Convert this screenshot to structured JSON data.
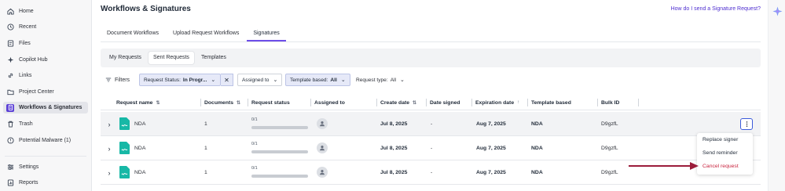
{
  "sidebar": {
    "items": [
      {
        "label": "Home",
        "icon": "home-icon"
      },
      {
        "label": "Recent",
        "icon": "clock-icon"
      },
      {
        "label": "Files",
        "icon": "files-icon"
      },
      {
        "label": "Copilot Hub",
        "icon": "sparkle-icon"
      },
      {
        "label": "Links",
        "icon": "link-icon"
      },
      {
        "label": "Project Center",
        "icon": "project-icon"
      },
      {
        "label": "Workflows & Signatures",
        "icon": "workflow-icon",
        "active": true
      },
      {
        "label": "Trash",
        "icon": "trash-icon"
      },
      {
        "label": "Potential Malware (1)",
        "icon": "shield-icon"
      },
      {
        "label": "Settings",
        "icon": "settings-icon"
      },
      {
        "label": "Reports",
        "icon": "reports-icon"
      }
    ]
  },
  "header": {
    "title": "Workflows & Signatures",
    "help_link": "How do I send a Signature Request?"
  },
  "tabs": [
    "Document Workflows",
    "Upload Request Workflows",
    "Signatures"
  ],
  "active_tab": "Signatures",
  "subtabs": [
    "My Requests",
    "Sent Requests",
    "Templates"
  ],
  "active_subtab": "Sent Requests",
  "filters": {
    "button_label": "Filters",
    "status_label": "Request Status:",
    "status_value": "In Progr...",
    "assigned_label": "Assigned to",
    "template_label": "Template based:",
    "template_value": "All",
    "type_label": "Request type:",
    "type_value": "All"
  },
  "table": {
    "columns": [
      "Request name",
      "Documents",
      "Request status",
      "Assigned to",
      "Create date",
      "Date signed",
      "Expiration date",
      "Template based",
      "Bulk ID"
    ],
    "rows": [
      {
        "name": "NDA",
        "documents": "1",
        "status_text": "0/1",
        "progress": 0,
        "create_date": "Jul 8, 2025",
        "date_signed": "-",
        "expiration_date": "Aug 7, 2025",
        "template": "NDA",
        "bulk_id": "D9gzfL"
      },
      {
        "name": "NDA",
        "documents": "1",
        "status_text": "0/1",
        "progress": 0,
        "create_date": "Jul 8, 2025",
        "date_signed": "-",
        "expiration_date": "Aug 7, 2025",
        "template": "NDA",
        "bulk_id": "D9gzfL"
      },
      {
        "name": "NDA",
        "documents": "1",
        "status_text": "0/1",
        "progress": 0,
        "create_date": "Jul 8, 2025",
        "date_signed": "-",
        "expiration_date": "Aug 7, 2025",
        "template": "NDA",
        "bulk_id": "D9gzfL"
      }
    ]
  },
  "row_menu": {
    "items": [
      "Replace signer",
      "Send reminder",
      "Cancel request"
    ]
  },
  "colors": {
    "accent": "#5b3fd6",
    "link": "#4f2fd0",
    "danger": "#c9243f",
    "arrow": "#9b1c3a",
    "doc_icon": "#17b8a6"
  }
}
